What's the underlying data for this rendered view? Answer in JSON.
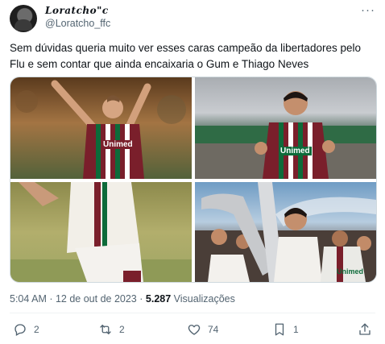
{
  "user": {
    "display_name": "Loratcho\"c",
    "handle": "@Loratcho_ffc"
  },
  "tweet": {
    "text": "Sem dúvidas queria muito ver esses caras campeão da libertadores pelo Flu e sem contar que ainda encaixaria o Gum e Thiago Neves"
  },
  "media": {
    "photos": [
      {
        "jersey_text": "Unimed"
      },
      {
        "jersey_text": "Unimed"
      },
      {
        "jersey_text": ""
      },
      {
        "jersey_text": "Unimed"
      }
    ]
  },
  "meta": {
    "timestamp": "5:04 AM · 12 de out de 2023 ·",
    "views_count": "5.287",
    "views_label": "Visualizações"
  },
  "actions": {
    "replies": "2",
    "retweets": "2",
    "likes": "74",
    "bookmarks": "1"
  },
  "icons": [
    "more-icon",
    "reply-icon",
    "retweet-icon",
    "like-icon",
    "bookmark-icon",
    "share-icon"
  ],
  "colors": {
    "text": "#0f1419",
    "secondary": "#536471",
    "border": "#cfd9de",
    "maroon": "#7a1f2b",
    "green": "#0d6b3a"
  }
}
